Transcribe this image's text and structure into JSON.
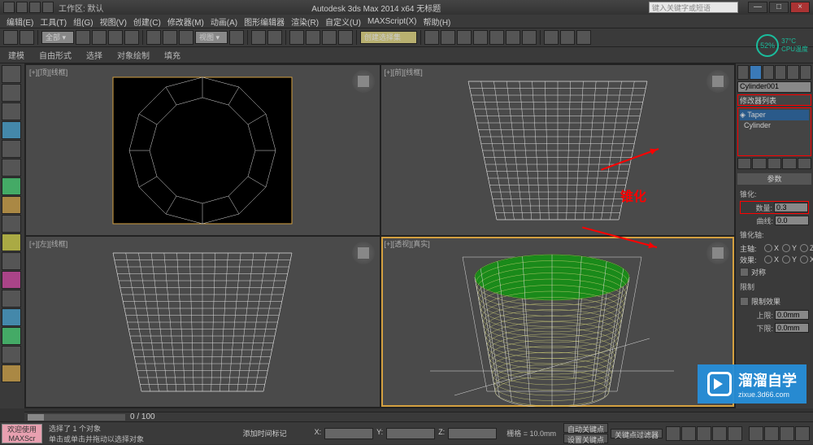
{
  "app": {
    "title": "Autodesk 3ds Max 2014 x64   无标题",
    "workspace": "工作区: 默认",
    "search_placeholder": "键入关键字或短语"
  },
  "menu": [
    "编辑(E)",
    "工具(T)",
    "组(G)",
    "视图(V)",
    "创建(C)",
    "修改器(M)",
    "动画(A)",
    "图形编辑器",
    "渲染(R)",
    "自定义(U)",
    "MAXScript(X)",
    "帮助(H)"
  ],
  "toolbar_drop": "创建选择集",
  "ribbon": [
    "建模",
    "自由形式",
    "选择",
    "对象绘制",
    "填充"
  ],
  "viewports": {
    "tl": "[+][顶][线框]",
    "tr": "[+][前][线框]",
    "bl": "[+][左][线框]",
    "br": "[+][透视][真实]"
  },
  "annot": {
    "taper_label": "锥化"
  },
  "panel": {
    "object_name": "Cylinder001",
    "mod_list_header": "修改器列表",
    "modifiers": [
      {
        "name": "Taper",
        "selected": true
      },
      {
        "name": "Cylinder",
        "selected": false
      }
    ],
    "rollup_params": "参数",
    "taper": {
      "amount_lbl": "数量:",
      "amount": "0.3",
      "curve_lbl": "曲线:",
      "curve": "0.0"
    },
    "axis_hdr": "锥化轴:",
    "primary_lbl": "主轴:",
    "axes": [
      "X",
      "Y",
      "Z"
    ],
    "effect_lbl": "效果:",
    "effect_axes": [
      "X",
      "Y",
      "XY"
    ],
    "symmetry": "对称",
    "limits_hdr": "限制",
    "limit_effect": "限制效果",
    "upper_lbl": "上限:",
    "upper": "0.0mm",
    "lower_lbl": "下限:",
    "lower": "0.0mm"
  },
  "status": {
    "script_btn": "欢迎使用 MAXScr",
    "line1": "选择了 1 个对象",
    "line2": "单击或单击并拖动以选择对象",
    "grid": "栅格 = 10.0mm",
    "auto_key": "自动关键点",
    "set_key": "设置关键点",
    "key_filter": "关键点过滤器",
    "add_time": "添加时间标记"
  },
  "cpu": {
    "pct": "52%",
    "temp": "37°C",
    "lbl": "CPU温度"
  },
  "watermark": {
    "title": "溜溜自学",
    "url": "zixue.3d66.com"
  },
  "timeline": {
    "range": "0 / 100"
  }
}
